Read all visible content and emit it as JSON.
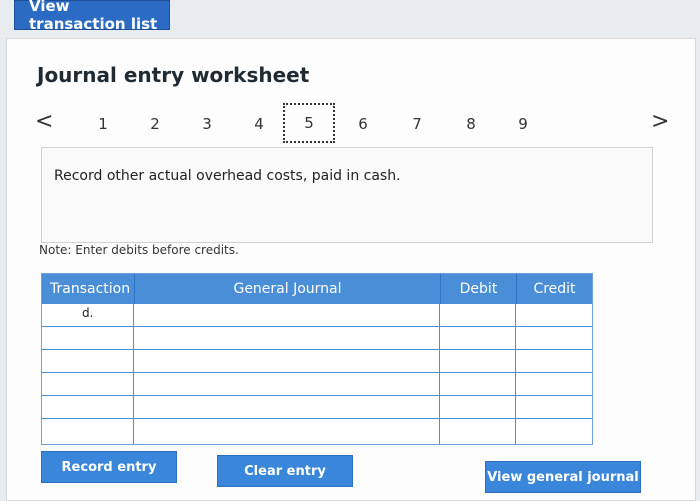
{
  "top_button": {
    "label": "View transaction list"
  },
  "panel": {
    "title": "Journal entry worksheet",
    "nav": {
      "prev": "<",
      "next": ">",
      "pages": [
        "1",
        "2",
        "3",
        "4",
        "5",
        "6",
        "7",
        "8",
        "9"
      ],
      "selected": "5"
    },
    "instruction": "Record other actual overhead costs, paid in cash.",
    "note": "Note: Enter debits before credits."
  },
  "table": {
    "headers": [
      "Transaction",
      "General Journal",
      "Debit",
      "Credit"
    ],
    "rows": [
      {
        "transaction": "d.",
        "journal": "",
        "debit": "",
        "credit": ""
      },
      {
        "transaction": "",
        "journal": "",
        "debit": "",
        "credit": ""
      },
      {
        "transaction": "",
        "journal": "",
        "debit": "",
        "credit": ""
      },
      {
        "transaction": "",
        "journal": "",
        "debit": "",
        "credit": ""
      },
      {
        "transaction": "",
        "journal": "",
        "debit": "",
        "credit": ""
      },
      {
        "transaction": "",
        "journal": "",
        "debit": "",
        "credit": ""
      }
    ]
  },
  "buttons": {
    "record": "Record entry",
    "clear": "Clear entry",
    "view_general": "View general journal"
  }
}
